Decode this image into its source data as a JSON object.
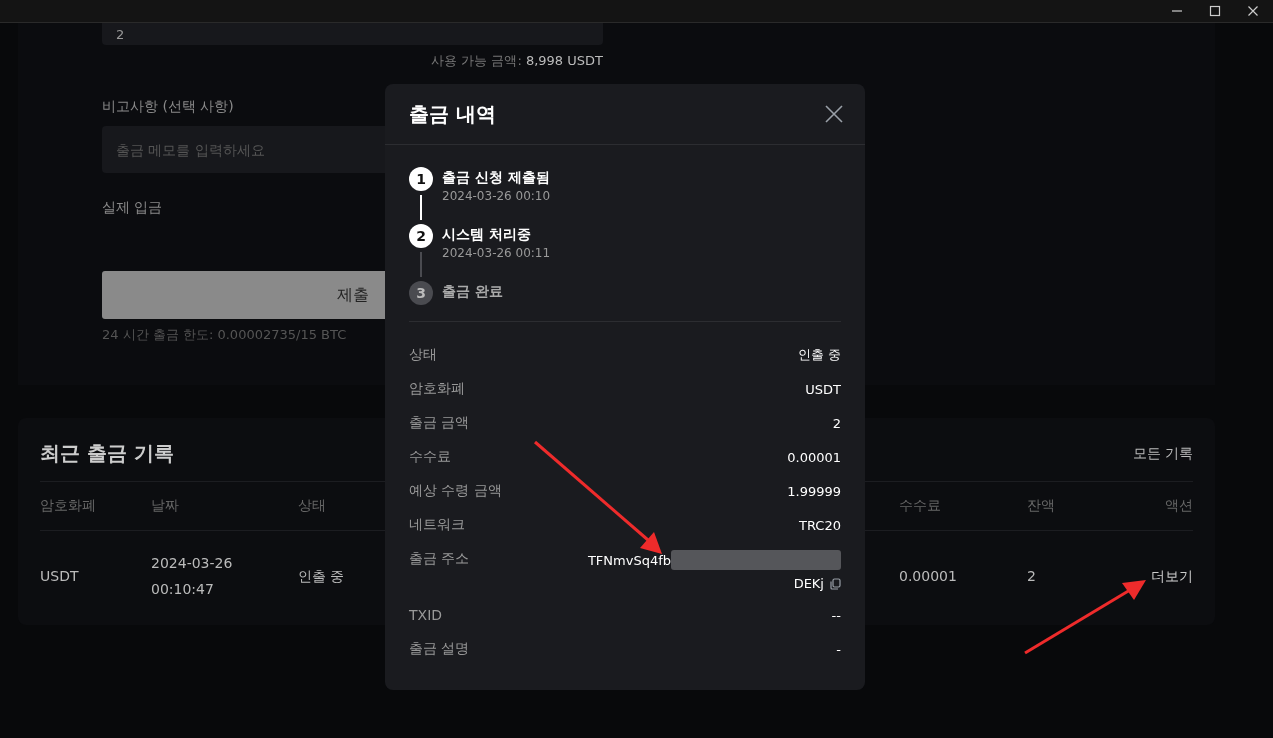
{
  "form": {
    "amount_value": "2",
    "available_label": "사용 가능 금액: ",
    "available_amount": "8,998 USDT",
    "memo_label": "비고사항 (선택 사항)",
    "memo_placeholder": "출금 메모를 입력하세요",
    "actual_label": "실제 입금",
    "submit": "제출",
    "limit": "24 시간 출금 한도: 0.00002735/15 BTC"
  },
  "history": {
    "title": "최근 출금 기록",
    "all_link": "모든 기록",
    "columns": [
      {
        "label": "암호화폐"
      },
      {
        "label": "날짜"
      },
      {
        "label": "상태"
      },
      {
        "label": "수수료"
      },
      {
        "label": "잔액"
      },
      {
        "label": "액션"
      }
    ],
    "rows": [
      {
        "cells": [
          "USDT",
          "2024-03-26\n00:10:47",
          "인출 중",
          "0.00001",
          "2"
        ],
        "action": "더보기"
      }
    ]
  },
  "modal": {
    "title": "출금 내역",
    "steps": [
      {
        "number": "1",
        "title": "출금 신청 제출됨",
        "time": "2024-03-26 00:10",
        "completed": true
      },
      {
        "number": "2",
        "title": "시스템 처리중",
        "time": "2024-03-26 00:11",
        "completed": true
      },
      {
        "number": "3",
        "title": "출금 완료",
        "completed": false
      }
    ],
    "details": [
      {
        "kind": "text",
        "label": "상태",
        "value": "인출 중"
      },
      {
        "kind": "text",
        "label": "암호화폐",
        "value": "USDT"
      },
      {
        "kind": "text",
        "label": "출금 금액",
        "value": "2"
      },
      {
        "kind": "text",
        "label": "수수료",
        "value": "0.00001"
      },
      {
        "kind": "text",
        "label": "예상 수령 금액",
        "value": "1.99999"
      },
      {
        "kind": "text",
        "label": "네트워크",
        "value": "TRC20"
      },
      {
        "kind": "address",
        "label": "출금 주소",
        "value_start": "TFNmvSq4fb",
        "value_end": "DEKj"
      },
      {
        "kind": "text",
        "label": "TXID",
        "value": "--"
      },
      {
        "kind": "text",
        "label": "출금 설명",
        "value": "-"
      }
    ]
  }
}
